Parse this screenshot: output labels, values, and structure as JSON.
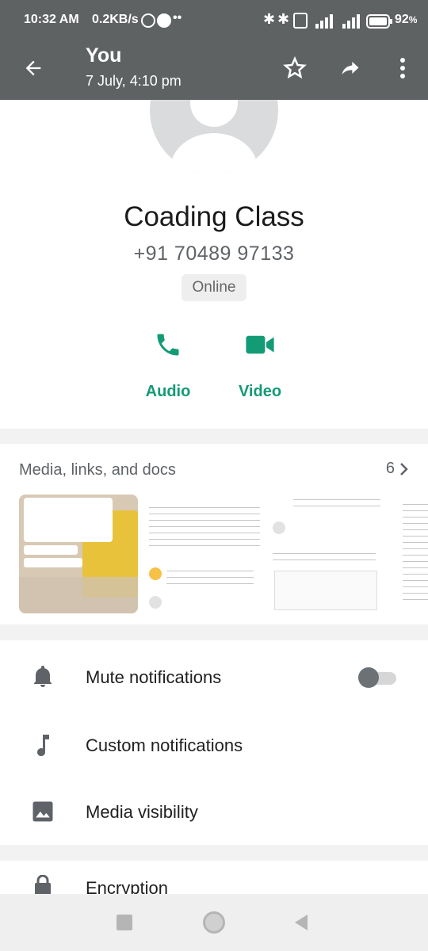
{
  "status_bar": {
    "time": "10:32 AM",
    "speed": "0.2KB/s",
    "battery": "92"
  },
  "app_bar": {
    "title": "You",
    "subtitle": "7 July, 4:10 pm"
  },
  "contact": {
    "name": "Coading Class",
    "phone": "+91 70489 97133",
    "status": "Online"
  },
  "actions": [
    {
      "label": "Audio",
      "icon": "phone-icon"
    },
    {
      "label": "Video",
      "icon": "video-icon"
    }
  ],
  "media": {
    "title": "Media, links, and docs",
    "count": "6"
  },
  "settings": [
    {
      "label": "Mute notifications",
      "icon": "bell-icon"
    },
    {
      "label": "Custom notifications",
      "icon": "music-note-icon"
    },
    {
      "label": "Media visibility",
      "icon": "image-icon"
    }
  ],
  "encryption": {
    "label": "Encryption"
  },
  "colors": {
    "accent": "#139b76",
    "overlay": "#5f6263"
  }
}
